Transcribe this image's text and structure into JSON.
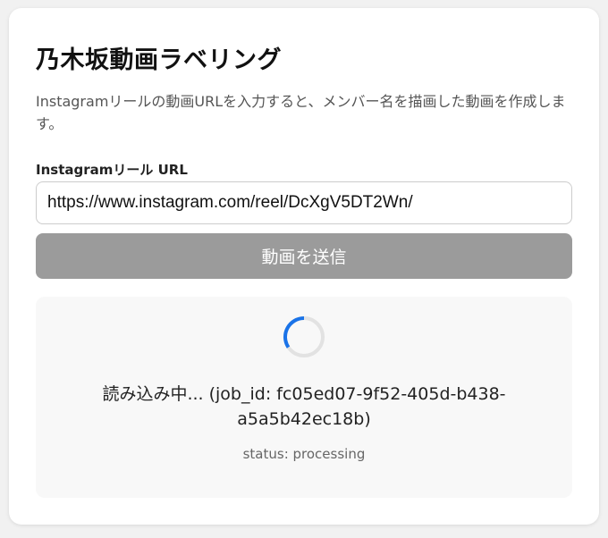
{
  "page": {
    "title": "乃木坂動画ラベリング",
    "description": "Instagramリールの動画URLを入力すると、メンバー名を描画した動画を作成します。"
  },
  "form": {
    "url_label": "Instagramリール URL",
    "url_value": "https://www.instagram.com/reel/DcXgV5DT2Wn/",
    "submit_label": "動画を送信"
  },
  "status": {
    "loading_text": "読み込み中... (job_id: fc05ed07-9f52-405d-b438-a5a5b42ec18b)",
    "status_text": "status: processing",
    "spinner_icon": "loading-spinner-icon"
  },
  "colors": {
    "button_disabled": "#9b9b9b",
    "spinner_accent": "#1a73e8",
    "spinner_track": "#e2e2e2"
  }
}
